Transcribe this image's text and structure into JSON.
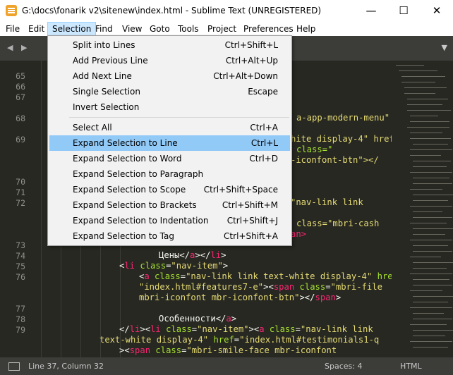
{
  "window": {
    "title": "G:\\docs\\fonarik v2\\sitenew\\index.html - Sublime Text (UNREGISTERED)",
    "minimize_glyph": "—",
    "maximize_glyph": "☐",
    "close_glyph": "✕",
    "icon": "sublime-text-icon"
  },
  "menubar": {
    "items": [
      "File",
      "Edit",
      "Selection",
      "Find",
      "View",
      "Goto",
      "Tools",
      "Project",
      "Preferences",
      "Help"
    ],
    "active": "Selection"
  },
  "tabbar": {
    "nav_glyph": "◀ ▶",
    "dropdown_glyph": "▼"
  },
  "selection_menu": {
    "items": [
      {
        "label": "Split into Lines",
        "shortcut": "Ctrl+Shift+L"
      },
      {
        "label": "Add Previous Line",
        "shortcut": "Ctrl+Alt+Up"
      },
      {
        "label": "Add Next Line",
        "shortcut": "Ctrl+Alt+Down"
      },
      {
        "label": "Single Selection",
        "shortcut": "Escape"
      },
      {
        "label": "Invert Selection",
        "shortcut": ""
      },
      {
        "label": "Select All",
        "shortcut": "Ctrl+A"
      },
      {
        "label": "Expand Selection to Line",
        "shortcut": "Ctrl+L"
      },
      {
        "label": "Expand Selection to Word",
        "shortcut": "Ctrl+D"
      },
      {
        "label": "Expand Selection to Paragraph",
        "shortcut": ""
      },
      {
        "label": "Expand Selection to Scope",
        "shortcut": "Ctrl+Shift+Space"
      },
      {
        "label": "Expand Selection to Brackets",
        "shortcut": "Ctrl+Shift+M"
      },
      {
        "label": "Expand Selection to Indentation",
        "shortcut": "Ctrl+Shift+J"
      },
      {
        "label": "Expand Selection to Tag",
        "shortcut": "Ctrl+Shift+A"
      }
    ],
    "highlighted": "Expand Selection to Line"
  },
  "editor": {
    "line_numbers": [
      "65",
      "66",
      "67",
      "68",
      "69",
      "70",
      "71",
      "72",
      "73",
      "74",
      "75",
      "76",
      "77",
      "78",
      "79"
    ],
    "visible_fragments": {
      "l68": "a-app-modern-menu\"",
      "l69a": "hite display-4\" href=",
      "l69b": "class=\"",
      "l69c": "-iconfont-btn\"></",
      "l72": "\"nav-link link",
      "l72b": "class=\"mbri-cash",
      "l72c": "an>"
    },
    "code_lines": {
      "l74_text": "Цены",
      "l75_class": "nav-item",
      "l76_class": "nav-link link text-white display-4",
      "l76_href": "index.html#features7-e",
      "l76_span_class_a": "mbri-file",
      "l76_span_class_b": "mbri-iconfont mbr-iconfont-btn",
      "l78_text": "Особенности",
      "l79_class": "nav-item",
      "l79_aclass_a": "nav-link link",
      "l79_aclass_b": "text-white display-4",
      "l79_href": "index.html#testimonials1-q",
      "l79_span_class": "mbri-smile-face mbr-iconfont"
    }
  },
  "statusbar": {
    "position": "Line 37, Column 32",
    "spaces": "Spaces: 4",
    "syntax": "HTML"
  },
  "colors": {
    "editor_bg": "#272822",
    "tag": "#f92672",
    "attribute": "#a6e22e",
    "string": "#e6db74",
    "menu_highlight": "#91c9f7",
    "menubar_active": "#cce8ff"
  }
}
